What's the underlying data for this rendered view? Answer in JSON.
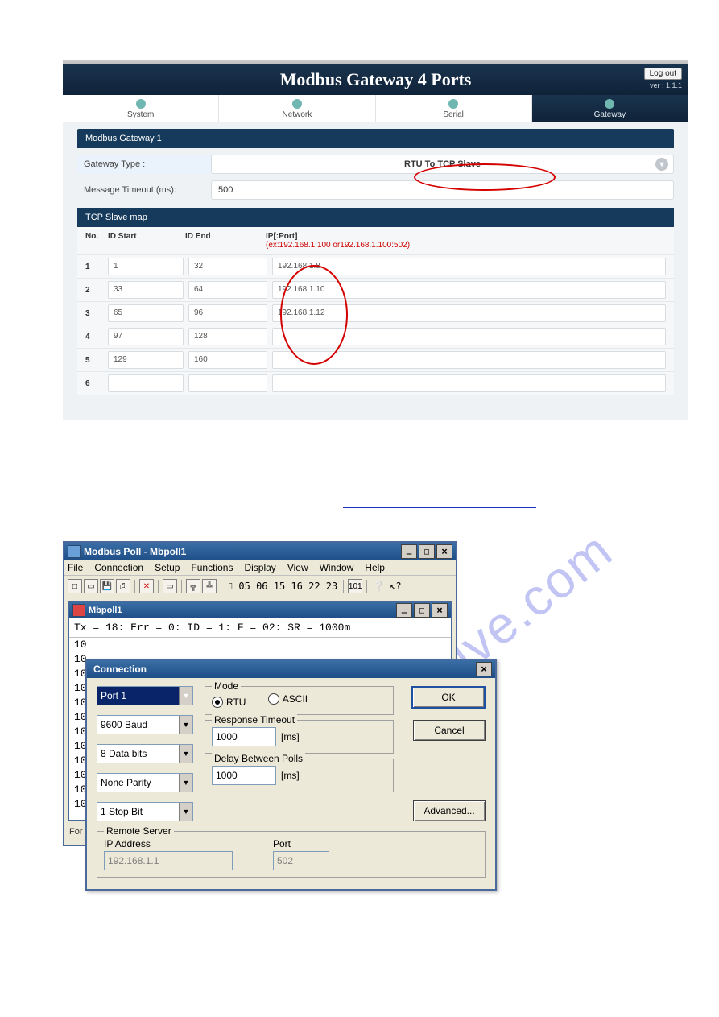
{
  "gateway": {
    "title": "Modbus Gateway 4 Ports",
    "logout": "Log out",
    "version": "ver : 1.1.1",
    "tabs": {
      "system": "System",
      "network": "Network",
      "serial": "Serial",
      "gateway": "Gateway"
    },
    "panel_title": "Modbus Gateway 1",
    "gateway_type_label": "Gateway Type :",
    "gateway_type_value": "RTU To TCP Slave",
    "msg_timeout_label": "Message Timeout (ms):",
    "msg_timeout_value": "500",
    "slavemap_title": "TCP Slave map",
    "tbl": {
      "hdr_no": "No.",
      "hdr_idstart": "ID Start",
      "hdr_idend": "ID End",
      "hdr_ipport": "IP[:Port]",
      "hdr_example_pre": "(ex:",
      "hdr_example_a": "192.168.1.100",
      "hdr_example_mid": " or",
      "hdr_example_b": "192.168.1.100:502",
      "hdr_example_post": ")"
    },
    "rows": [
      {
        "no": "1",
        "ids": "1",
        "ide": "32",
        "ip": "192.168.1.8"
      },
      {
        "no": "2",
        "ids": "33",
        "ide": "64",
        "ip": "192.168.1.10"
      },
      {
        "no": "3",
        "ids": "65",
        "ide": "96",
        "ip": "192.168.1.12"
      },
      {
        "no": "4",
        "ids": "97",
        "ide": "128",
        "ip": ""
      },
      {
        "no": "5",
        "ids": "129",
        "ide": "160",
        "ip": ""
      },
      {
        "no": "6",
        "ids": "",
        "ide": "",
        "ip": ""
      }
    ]
  },
  "poll": {
    "app_title": "Modbus Poll - Mbpoll1",
    "menu": {
      "file": "File",
      "connection": "Connection",
      "setup": "Setup",
      "functions": "Functions",
      "display": "Display",
      "view": "View",
      "window": "Window",
      "help": "Help"
    },
    "toolbar_codes": "05 06 15 16 22 23",
    "toolbar_101": "101",
    "doc_title": "Mbpoll1",
    "status_line": "Tx = 18: Err = 0: ID = 1: F = 02: SR = 1000m",
    "numbers": [
      "10",
      "10",
      "10",
      "10",
      "10",
      "10",
      "10",
      "10",
      "10",
      "10",
      "10",
      "10"
    ],
    "status_bar": "For H"
  },
  "dlg": {
    "title": "Connection",
    "port": "Port 1",
    "baud": "9600 Baud",
    "databits": "8 Data bits",
    "parity": "None Parity",
    "stopbit": "1 Stop Bit",
    "mode_legend": "Mode",
    "mode_rtu": "RTU",
    "mode_ascii": "ASCII",
    "rt_legend": "Response Timeout",
    "rt_value": "1000",
    "rt_unit": "[ms]",
    "dbp_legend": "Delay Between Polls",
    "dbp_value": "1000",
    "dbp_unit": "[ms]",
    "rs_legend": "Remote Server",
    "rs_ip_label": "IP Address",
    "rs_ip_value": "192.168.1.1",
    "rs_port_label": "Port",
    "rs_port_value": "502",
    "btn_ok": "OK",
    "btn_cancel": "Cancel",
    "btn_adv": "Advanced..."
  },
  "watermark": "manualshive.com"
}
